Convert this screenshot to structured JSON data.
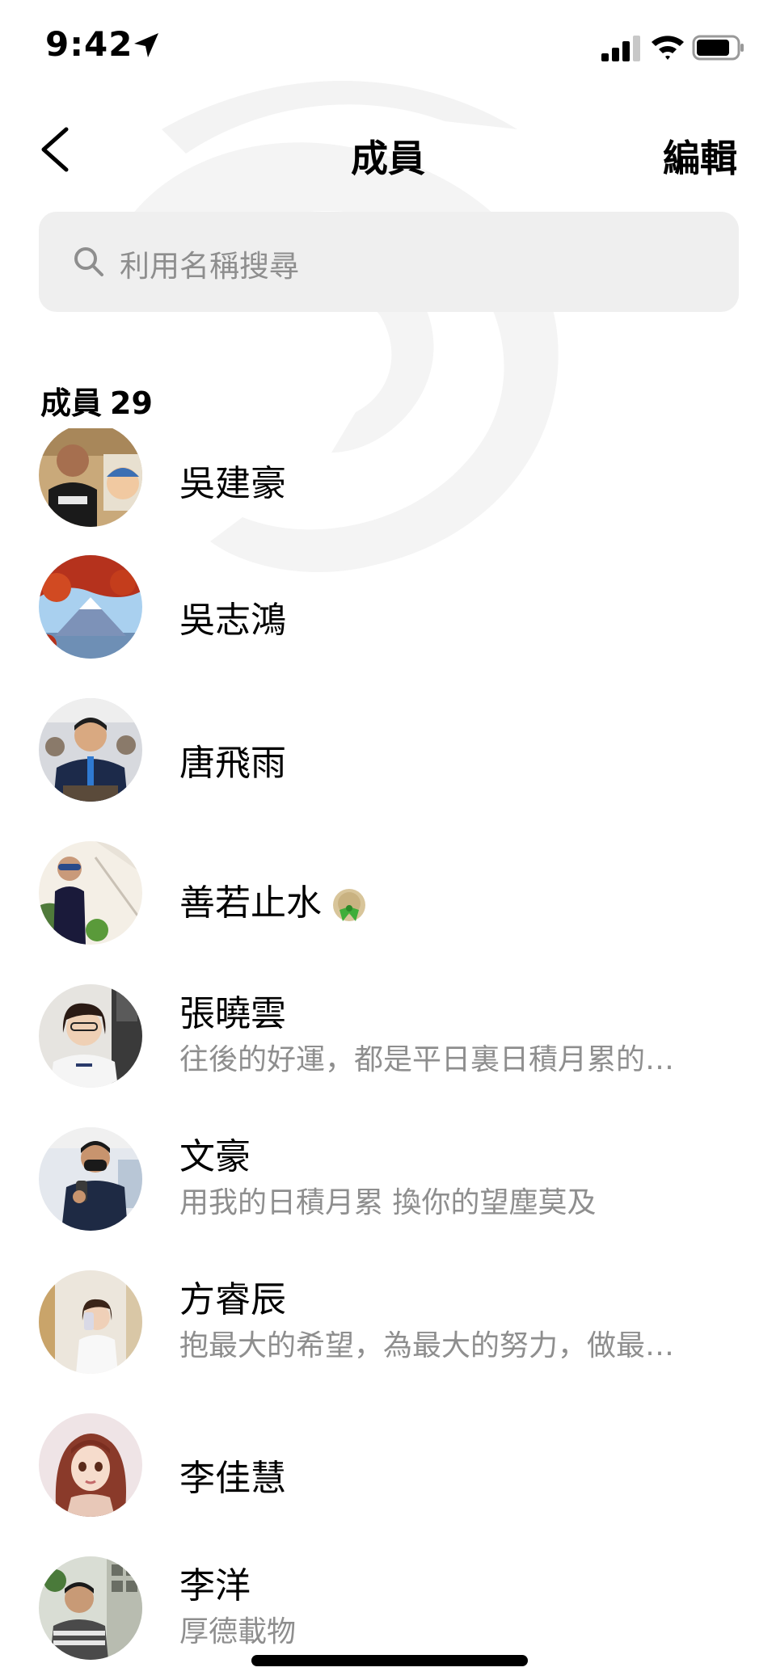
{
  "status_bar": {
    "time": "9:42"
  },
  "header": {
    "title": "成員",
    "edit_label": "編輯"
  },
  "search": {
    "placeholder": "利用名稱搜尋"
  },
  "members_section": {
    "label": "成員",
    "count": "29"
  },
  "members": [
    {
      "name": "吳建豪",
      "bio": ""
    },
    {
      "name": "吳志鴻",
      "bio": ""
    },
    {
      "name": "唐飛雨",
      "bio": ""
    },
    {
      "name": "善若止水",
      "bio": "",
      "emoji": "green-bow-bun-icon"
    },
    {
      "name": "張曉雲",
      "bio": "往後的好運，都是平日裏日積月累的…"
    },
    {
      "name": "文豪",
      "bio": "用我的日積月累 換你的望塵莫及"
    },
    {
      "name": "方睿辰",
      "bio": "抱最大的希望，為最大的努力，做最…"
    },
    {
      "name": "李佳慧",
      "bio": ""
    },
    {
      "name": "李洋",
      "bio": "厚德載物"
    }
  ]
}
